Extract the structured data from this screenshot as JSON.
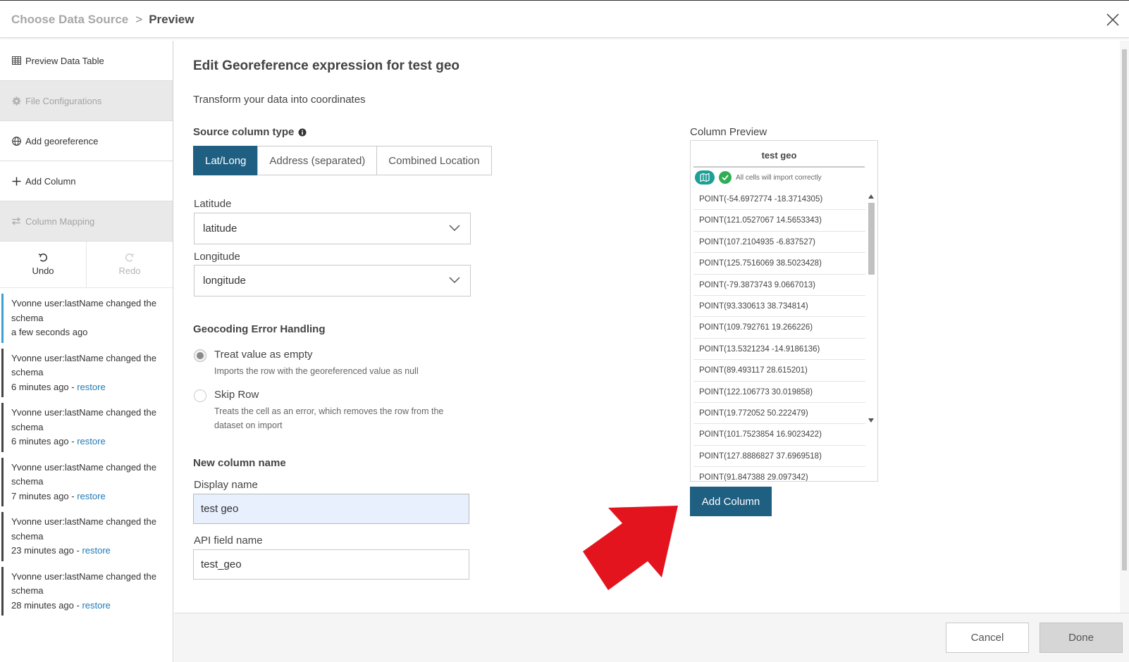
{
  "header": {
    "breadcrumb_parent": "Choose Data Source",
    "breadcrumb_separator": ">",
    "breadcrumb_current": "Preview"
  },
  "sidebar": {
    "items": [
      {
        "label": "Preview Data Table",
        "icon": "table-icon",
        "disabled": false
      },
      {
        "label": "File Configurations",
        "icon": "gear-icon",
        "disabled": true
      },
      {
        "label": "Add georeference",
        "icon": "globe-icon",
        "disabled": false
      },
      {
        "label": "Add Column",
        "icon": "plus-icon",
        "disabled": false
      },
      {
        "label": "Column Mapping",
        "icon": "swap-arrows-icon",
        "disabled": true
      }
    ],
    "undo_label": "Undo",
    "redo_label": "Redo",
    "history": [
      {
        "text": "Yvonne user:lastName changed the schema",
        "time": "a few seconds ago",
        "restore": ""
      },
      {
        "text": "Yvonne user:lastName changed the schema",
        "time": "6 minutes ago - ",
        "restore": "restore"
      },
      {
        "text": "Yvonne user:lastName changed the schema",
        "time": "6 minutes ago - ",
        "restore": "restore"
      },
      {
        "text": "Yvonne user:lastName changed the schema",
        "time": "7 minutes ago - ",
        "restore": "restore"
      },
      {
        "text": "Yvonne user:lastName changed the schema",
        "time": "23 minutes ago - ",
        "restore": "restore"
      },
      {
        "text": "Yvonne user:lastName changed the schema",
        "time": "28 minutes ago - ",
        "restore": "restore"
      }
    ]
  },
  "main": {
    "title": "Edit Georeference expression for test geo",
    "subtitle": "Transform your data into coordinates",
    "source_type_label": "Source column type",
    "source_types": [
      "Lat/Long",
      "Address (separated)",
      "Combined Location"
    ],
    "selected_source_type": "Lat/Long",
    "latitude_label": "Latitude",
    "latitude_value": "latitude",
    "longitude_label": "Longitude",
    "longitude_value": "longitude",
    "error_handling_label": "Geocoding Error Handling",
    "error_options": [
      {
        "title": "Treat value as empty",
        "desc": "Imports the row with the georeferenced value as null",
        "selected": true
      },
      {
        "title": "Skip Row",
        "desc": "Treats the cell as an error, which removes the row from the dataset on import",
        "selected": false
      }
    ],
    "new_column_label": "New column name",
    "display_name_label": "Display name",
    "display_name_value": "test geo",
    "api_field_label": "API field name",
    "api_field_value": "test_geo"
  },
  "preview": {
    "label": "Column Preview",
    "column_name": "test geo",
    "status_text": "All cells will import correctly",
    "cells": [
      "POINT(-54.6972774 -18.3714305)",
      "POINT(121.0527067 14.5653343)",
      "POINT(107.2104935 -6.837527)",
      "POINT(125.7516069 38.5023428)",
      "POINT(-79.3873743 9.0667013)",
      "POINT(93.330613 38.734814)",
      "POINT(109.792761 19.266226)",
      "POINT(13.5321234 -14.9186136)",
      "POINT(89.493117 28.615201)",
      "POINT(122.106773 30.019858)",
      "POINT(19.772052 50.222479)",
      "POINT(101.7523854 16.9023422)",
      "POINT(127.8886827 37.6969518)",
      "POINT(91.847388 29.097342)"
    ],
    "add_button": "Add Column"
  },
  "footer": {
    "cancel": "Cancel",
    "done": "Done"
  },
  "colors": {
    "primary": "#1f5f82",
    "arrow": "#e3141e",
    "link": "#1f7ab8",
    "success": "#2fae55",
    "map_badge": "#1f9e96"
  }
}
